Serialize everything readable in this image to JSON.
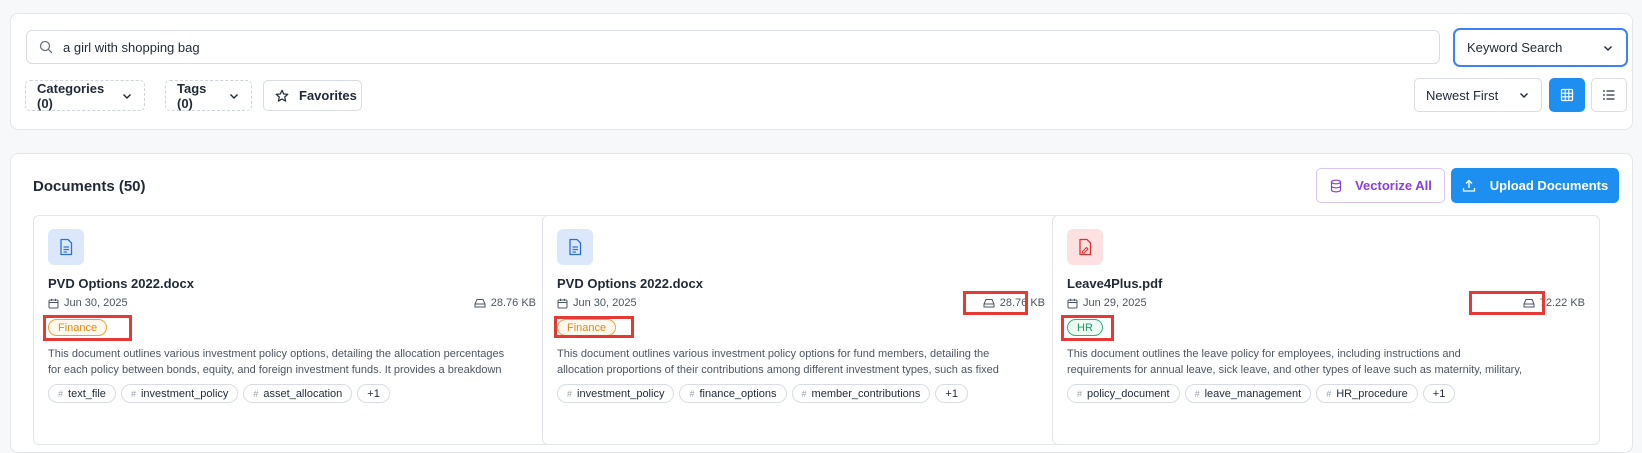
{
  "search": {
    "query": "a girl with shopping bag",
    "mode": "Keyword Search"
  },
  "filters": {
    "categories": "Categories (0)",
    "tags": "Tags (0)",
    "favorites": "Favorites"
  },
  "sort": "Newest First",
  "documents": {
    "title": "Documents (50)",
    "vectorize_label": "Vectorize All",
    "upload_label": "Upload Documents"
  },
  "cards": [
    {
      "name": "PVD Options 2022.docx",
      "date": "Jun 30, 2025",
      "size": "28.76 KB",
      "category": "Finance",
      "description": "This document outlines various investment policy options, detailing the allocation percentages for each policy between bonds, equity, and foreign investment funds. It provides a breakdown for...",
      "tags": [
        "text_file",
        "investment_policy",
        "asset_allocation"
      ],
      "more": "+1",
      "icon": "docx-file-icon"
    },
    {
      "name": "PVD Options 2022.docx",
      "date": "Jun 30, 2025",
      "size": "28.76 KB",
      "category": "Finance",
      "description": "This document outlines various investment policy options for fund members, detailing the allocation proportions of their contributions among different investment types, such as fixed income, equity, an...",
      "tags": [
        "investment_policy",
        "finance_options",
        "member_contributions"
      ],
      "more": "+1",
      "icon": "docx-file-icon"
    },
    {
      "name": "Leave4Plus.pdf",
      "date": "Jun 29, 2025",
      "size": "72.22 KB",
      "category": "HR",
      "description": "This document outlines the leave policy for employees, including instructions and requirements for annual leave, sick leave, and other types of leave such as maternity, military, and training leave. It...",
      "tags": [
        "policy_document",
        "leave_management",
        "HR_procedure"
      ],
      "more": "+1",
      "icon": "pdf-file-icon"
    }
  ],
  "colors": {
    "accent": "#1d8ff1",
    "vectorize": "#8b3fdc",
    "finance": "#e08a1a",
    "hr": "#1d9a66",
    "highlight": "#e53935"
  }
}
